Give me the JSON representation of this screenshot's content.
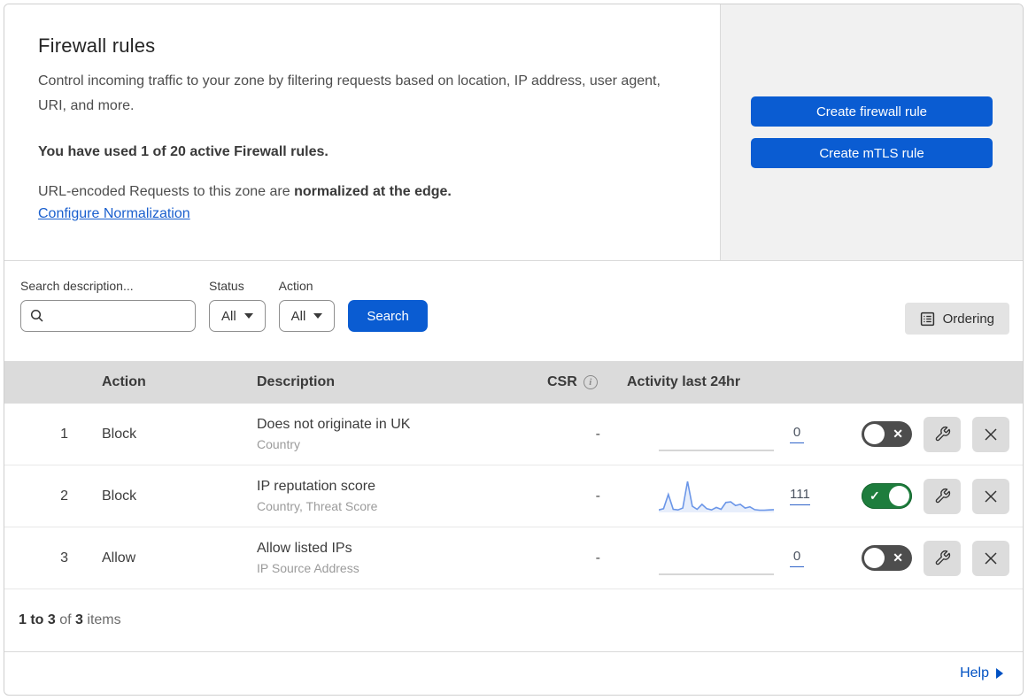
{
  "header": {
    "title": "Firewall rules",
    "description": "Control incoming traffic to your zone by filtering requests based on location, IP address, user agent, URI, and more.",
    "usage": "You have used 1 of 20 active Firewall rules.",
    "normalization_text": "URL-encoded Requests to this zone are",
    "normalization_bold": "normalized at the edge.",
    "normalization_link": "Configure Normalization",
    "buttons": [
      {
        "label": "Create firewall rule"
      },
      {
        "label": "Create mTLS rule"
      }
    ]
  },
  "filters": {
    "search_label": "Search description...",
    "search_value": "",
    "status_label": "Status",
    "status_value": "All",
    "action_label": "Action",
    "action_value": "All",
    "search_button": "Search",
    "ordering_button": "Ordering"
  },
  "table": {
    "columns": {
      "action": "Action",
      "description": "Description",
      "csr": "CSR",
      "activity": "Activity last 24hr"
    },
    "rows": [
      {
        "index": "1",
        "action": "Block",
        "description": "Does not originate in UK",
        "criteria": "Country",
        "csr": "-",
        "activity_count": "0",
        "enabled": false,
        "sparkline": [
          0,
          0
        ]
      },
      {
        "index": "2",
        "action": "Block",
        "description": "IP reputation score",
        "criteria": "Country, Threat Score",
        "csr": "-",
        "activity_count": "111",
        "enabled": true,
        "sparkline": [
          8,
          12,
          58,
          10,
          8,
          14,
          100,
          20,
          10,
          26,
          12,
          8,
          16,
          10,
          32,
          34,
          22,
          26,
          14,
          18,
          9,
          7,
          7,
          8,
          9
        ]
      },
      {
        "index": "3",
        "action": "Allow",
        "description": "Allow listed IPs",
        "criteria": "IP Source Address",
        "csr": "-",
        "activity_count": "0",
        "enabled": false,
        "sparkline": [
          0,
          0
        ]
      }
    ],
    "footer": {
      "range": "1 to 3",
      "of": "of",
      "total": "3",
      "items": "items"
    }
  },
  "help_link": "Help",
  "colors": {
    "primary_blue": "#0a5cd2",
    "link_blue": "#1a5fce",
    "help_blue": "#0051c3",
    "toggle_on_green": "#1e7d3d",
    "toggle_off_gray": "#4d4d4d",
    "sparkline_blue": "#6b96e8",
    "sparkline_flat_gray": "#c9c9c9",
    "panel_gray": "#f1f1f1",
    "table_header_gray": "#dbdbdb"
  }
}
